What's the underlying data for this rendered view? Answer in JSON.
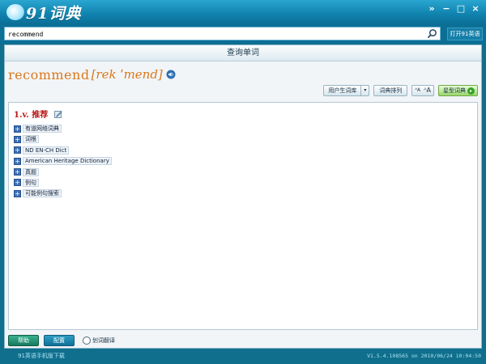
{
  "app": {
    "logo_text": "91词典",
    "window_controls": [
      "»",
      "−",
      "□",
      "×"
    ]
  },
  "search": {
    "value": "recommend",
    "icon": "search-icon",
    "open_button_label": "打开91英语"
  },
  "panel": {
    "header_title": "查询单词",
    "headword": "recommend",
    "phonetic": "[rek ˈmend]",
    "speaker_icon": "speaker-icon"
  },
  "toolbar": {
    "user_dict_label": "用户生词库",
    "dropdown_arrow": "▾",
    "dict_order_label": "词典排列",
    "font_decrease_label": "ᴬA",
    "font_increase_label": "ᴬA",
    "star_dict_label": "星型词典",
    "star_dict_badge": "▸"
  },
  "content": {
    "meaning": "1.v. 推荐",
    "sections": [
      {
        "label": "有道网络词典"
      },
      {
        "label": "词根"
      },
      {
        "label": "ND EN-CH Dict"
      },
      {
        "label": "American Heritage Dictionary"
      },
      {
        "label": "真题"
      },
      {
        "label": "例句"
      },
      {
        "label": "可能例句搜索"
      }
    ],
    "expand_glyph": "+"
  },
  "footer": {
    "help_label": "帮助",
    "config_label": "配置",
    "translate_label": "划词翻译"
  },
  "status": {
    "left_text": "91英语手机版下载",
    "right_text": "V1.5.4.108565 on 2010/06/24 10:04:50"
  },
  "colors": {
    "titlebar": "#0f82ad",
    "headword": "#d9781a",
    "meaning": "#b81818",
    "expand_button": "#3a6fb5"
  }
}
